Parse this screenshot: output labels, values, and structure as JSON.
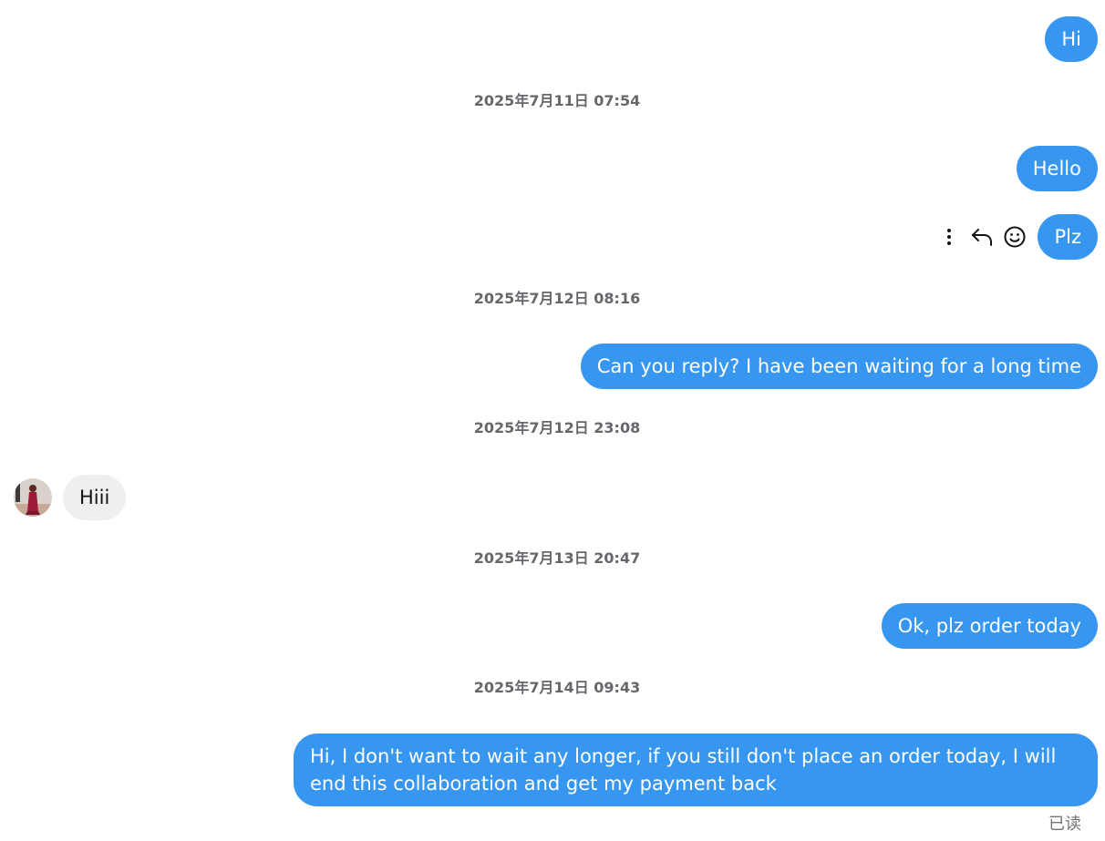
{
  "messages": {
    "m1": "Hi",
    "m2": "Hello",
    "m3": "Plz",
    "m4": "Can you reply? I have been waiting for a long time",
    "m5": "Hiii",
    "m6": "Ok, plz order today",
    "m7": "Hi, I don't want to wait any longer, if you still don't place an order today, I will end this collaboration and get my payment back"
  },
  "timestamps": {
    "t1": "2025年7月11日 07:54",
    "t2": "2025年7月12日 08:16",
    "t3": "2025年7月12日 23:08",
    "t4": "2025年7月13日 20:47",
    "t5": "2025年7月14日 09:43"
  },
  "status": {
    "seen": "已读"
  },
  "icons": {
    "more": "more-vertical-icon",
    "reply": "reply-icon",
    "react": "emoji-react-icon"
  },
  "colors": {
    "outgoing_bubble": "#3797f0",
    "incoming_bubble": "#efefef",
    "timestamp": "#65676b"
  }
}
